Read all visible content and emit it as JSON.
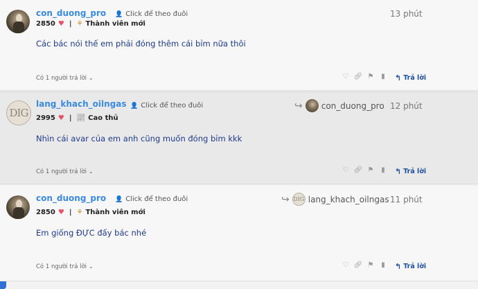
{
  "posts": [
    {
      "username": "con_duong_pro",
      "follow_label": "Click để theo đuôi",
      "points": "2850",
      "rank": "Thành viên mới",
      "time": "13 phút",
      "content": "Các bác nói thế em phải đóng thêm cái bỉm nữa thôi",
      "replies_label": "Có 1 người trả lời",
      "reply_label": "Trả lời"
    },
    {
      "username": "lang_khach_oilngas",
      "avatar_text": "DIG",
      "follow_label": "Click để theo đuôi",
      "points": "2995",
      "rank": "Cao thủ",
      "reply_to_user": "con_duong_pro",
      "time": "12 phút",
      "content": "Nhìn cái avar của em anh cũng muốn đóng bỉm kkk",
      "replies_label": "Có 1 người trả lời",
      "reply_label": "Trả lời"
    },
    {
      "username": "con_duong_pro",
      "follow_label": "Click để theo đuôi",
      "points": "2850",
      "rank": "Thành viên mới",
      "reply_to_user": "lang_khach_oilngas",
      "reply_to_avatar_text": "DIG",
      "time": "11 phút",
      "content": "Em giống ĐỰC đấy bác nhé",
      "replies_label": "Có 1 người trả lời",
      "reply_label": "Trả lời"
    }
  ],
  "colors": {
    "username": "#3a8be0",
    "content": "#1e3a8a",
    "reply_button": "#1d4f9c",
    "heart": "#e5506a"
  },
  "icons": {
    "follow": "user-plus-icon",
    "heart": "heart-icon",
    "rank_new": "sprout-icon",
    "rank_expert": "chart-icon",
    "like": "heart-outline-icon",
    "link": "link-icon",
    "flag": "flag-icon",
    "bookmark": "bookmark-icon",
    "reply": "reply-arrow-icon",
    "reply_to": "share-arrow-icon",
    "expand": "chevron-down-icon"
  }
}
